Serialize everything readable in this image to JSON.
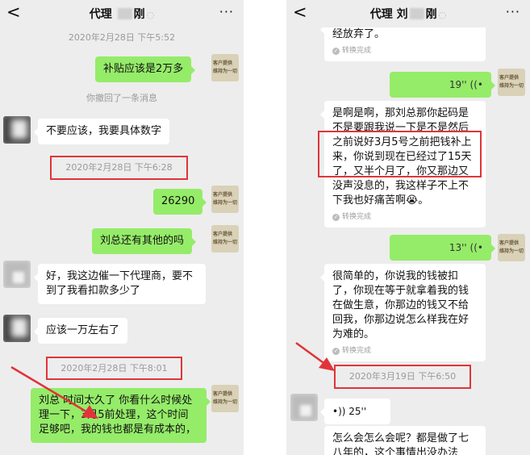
{
  "left_screen": {
    "header": {
      "back_glyph": "<",
      "title_prefix": "代理 ",
      "title_suffix": "刚",
      "more_glyph": "···"
    },
    "timestamps": [
      "2020年2月28日 下午5:52",
      "2020年2月28日 下午6:28",
      "2020年2月28日 下午8:01"
    ],
    "system_notice": "你撤回了一条消息",
    "messages": [
      "补贴应该是2万多",
      "不要应该，我要具体数字",
      "26290",
      "刘总还有其他的吗",
      "好，我这边催一下代理商，要不到了我看扣款多少了",
      "应该一万左右了",
      "刘总 时间太久了 你看什么时候处理一下，3月5前处理，这个时间足够吧，我的钱也都是有成本的，"
    ],
    "self_avatar_text": [
      "客户提供",
      "维持为一切"
    ]
  },
  "right_screen": {
    "header": {
      "back_glyph": "<",
      "title_prefix": "代理 刘",
      "title_suffix": "刚",
      "more_glyph": "···"
    },
    "top_partial_text": "经放弃了。",
    "converted_label": "转换完成",
    "voice_messages": [
      "19''",
      "13''",
      "25''"
    ],
    "messages": [
      "是啊是啊，那刘总那你起码是不是要跟我说一下是不是然后之前说好3月5号之前把钱补上来，你说到现在已经过了15天了，又半个月了，你又那边又没声没息的，我这样子不上不下我也好痛苦啊😭。",
      "很简单的，你说我的钱被扣了，你现在等于就拿着我的钱在做生意，你那边的钱又不给回我，你那边说怎么样我在好为难的。",
      "怎么会怎么会呢？都是做了七八年的，这个事情出没办法"
    ],
    "timestamp": "2020年3月19日 下午6:50"
  },
  "colors": {
    "green_bubble": "#95ec69",
    "highlight_red": "#e0343a",
    "background": "#ededed"
  }
}
